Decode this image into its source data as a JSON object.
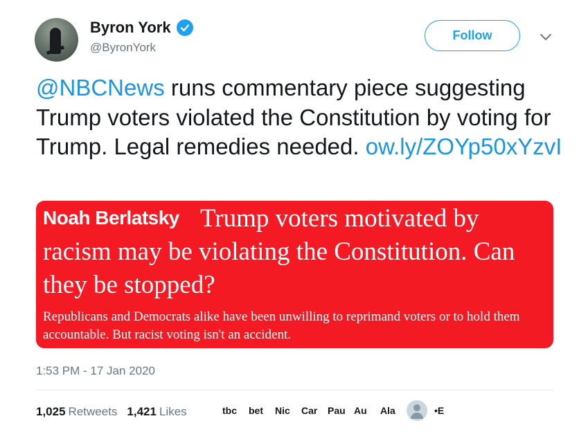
{
  "author": {
    "name": "Byron York",
    "handle": "@ByronYork"
  },
  "follow_label": "Follow",
  "tweet": {
    "mention": "@NBCNews",
    "text": " runs commentary piece suggesting Trump voters violated the Constitution by voting for Trump. Legal remedies needed. ",
    "link": "ow.ly/ZOYp50xYzvI"
  },
  "card": {
    "author": "Noah Berlatsky",
    "headline": "Trump voters motivated by racism may be violating the Constitution. Can they be stopped?",
    "summary": "Republicans and Democrats alike have been unwilling to reprimand voters or to hold them accountable. But racist voting isn't an accident.",
    "background_color": "#f41a24"
  },
  "timestamp": "1:53 PM - 17 Jan 2020",
  "stats": {
    "retweets_count": "1,025",
    "retweets_label": "Retweets",
    "likes_count": "1,421",
    "likes_label": "Likes"
  },
  "likers": [
    "tbc",
    "bet",
    "Nic",
    "Car",
    "Pau",
    "Au",
    "Ala"
  ],
  "likers_more": "•E",
  "colors": {
    "accent": "#1da1f2",
    "link": "#1b95e0",
    "muted": "#657786"
  },
  "icons": {
    "verified": "verified-badge-icon",
    "caret": "chevron-down-icon"
  }
}
